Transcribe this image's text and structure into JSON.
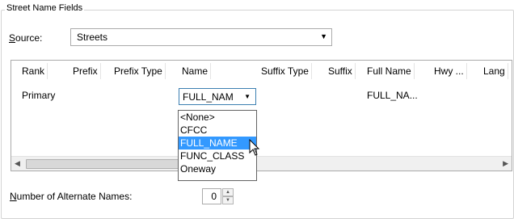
{
  "group": {
    "title": "Street Name Fields"
  },
  "source": {
    "label_prefix": "S",
    "label_rest": "ource:",
    "value": "Streets"
  },
  "grid": {
    "columns": [
      "Rank",
      "Prefix",
      "Prefix Type",
      "Name",
      "Suffix Type",
      "Suffix",
      "Full Name",
      "Hwy ...",
      "Lang"
    ],
    "row": {
      "rank": "Primary",
      "name": "FULL_NAM",
      "full_name": "FULL_NA..."
    }
  },
  "dropdown": {
    "options": [
      "<None>",
      "CFCC",
      "FULL_NAME",
      "FUNC_CLASS",
      "Oneway"
    ],
    "selected": "FULL_NAME"
  },
  "alternate": {
    "label_prefix": "N",
    "label_rest": "umber of Alternate Names:",
    "value": "0"
  },
  "colors": {
    "selection": "#3399ff",
    "focus_border": "#3c7fb1"
  }
}
